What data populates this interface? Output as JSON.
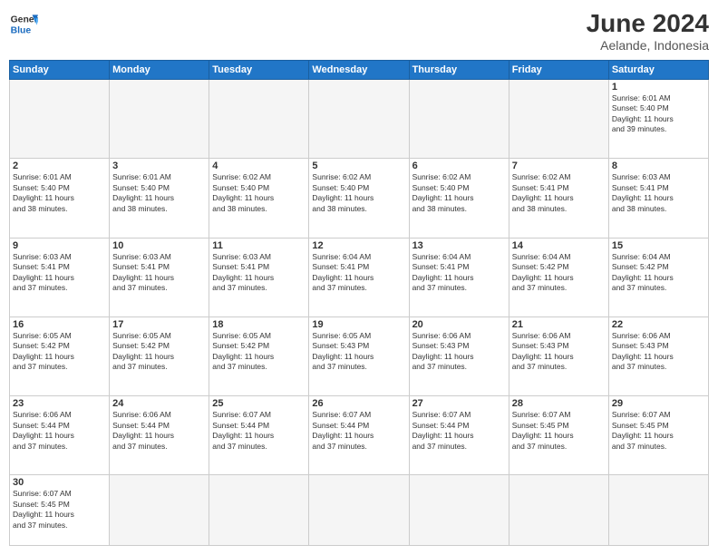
{
  "header": {
    "logo_general": "General",
    "logo_blue": "Blue",
    "month_year": "June 2024",
    "location": "Aelande, Indonesia"
  },
  "days_of_week": [
    "Sunday",
    "Monday",
    "Tuesday",
    "Wednesday",
    "Thursday",
    "Friday",
    "Saturday"
  ],
  "weeks": [
    [
      {
        "day": "",
        "info": ""
      },
      {
        "day": "",
        "info": ""
      },
      {
        "day": "",
        "info": ""
      },
      {
        "day": "",
        "info": ""
      },
      {
        "day": "",
        "info": ""
      },
      {
        "day": "",
        "info": ""
      },
      {
        "day": "1",
        "info": "Sunrise: 6:01 AM\nSunset: 5:40 PM\nDaylight: 11 hours\nand 39 minutes."
      }
    ],
    [
      {
        "day": "2",
        "info": "Sunrise: 6:01 AM\nSunset: 5:40 PM\nDaylight: 11 hours\nand 38 minutes."
      },
      {
        "day": "3",
        "info": "Sunrise: 6:01 AM\nSunset: 5:40 PM\nDaylight: 11 hours\nand 38 minutes."
      },
      {
        "day": "4",
        "info": "Sunrise: 6:02 AM\nSunset: 5:40 PM\nDaylight: 11 hours\nand 38 minutes."
      },
      {
        "day": "5",
        "info": "Sunrise: 6:02 AM\nSunset: 5:40 PM\nDaylight: 11 hours\nand 38 minutes."
      },
      {
        "day": "6",
        "info": "Sunrise: 6:02 AM\nSunset: 5:40 PM\nDaylight: 11 hours\nand 38 minutes."
      },
      {
        "day": "7",
        "info": "Sunrise: 6:02 AM\nSunset: 5:41 PM\nDaylight: 11 hours\nand 38 minutes."
      },
      {
        "day": "8",
        "info": "Sunrise: 6:03 AM\nSunset: 5:41 PM\nDaylight: 11 hours\nand 38 minutes."
      }
    ],
    [
      {
        "day": "9",
        "info": "Sunrise: 6:03 AM\nSunset: 5:41 PM\nDaylight: 11 hours\nand 37 minutes."
      },
      {
        "day": "10",
        "info": "Sunrise: 6:03 AM\nSunset: 5:41 PM\nDaylight: 11 hours\nand 37 minutes."
      },
      {
        "day": "11",
        "info": "Sunrise: 6:03 AM\nSunset: 5:41 PM\nDaylight: 11 hours\nand 37 minutes."
      },
      {
        "day": "12",
        "info": "Sunrise: 6:04 AM\nSunset: 5:41 PM\nDaylight: 11 hours\nand 37 minutes."
      },
      {
        "day": "13",
        "info": "Sunrise: 6:04 AM\nSunset: 5:41 PM\nDaylight: 11 hours\nand 37 minutes."
      },
      {
        "day": "14",
        "info": "Sunrise: 6:04 AM\nSunset: 5:42 PM\nDaylight: 11 hours\nand 37 minutes."
      },
      {
        "day": "15",
        "info": "Sunrise: 6:04 AM\nSunset: 5:42 PM\nDaylight: 11 hours\nand 37 minutes."
      }
    ],
    [
      {
        "day": "16",
        "info": "Sunrise: 6:05 AM\nSunset: 5:42 PM\nDaylight: 11 hours\nand 37 minutes."
      },
      {
        "day": "17",
        "info": "Sunrise: 6:05 AM\nSunset: 5:42 PM\nDaylight: 11 hours\nand 37 minutes."
      },
      {
        "day": "18",
        "info": "Sunrise: 6:05 AM\nSunset: 5:42 PM\nDaylight: 11 hours\nand 37 minutes."
      },
      {
        "day": "19",
        "info": "Sunrise: 6:05 AM\nSunset: 5:43 PM\nDaylight: 11 hours\nand 37 minutes."
      },
      {
        "day": "20",
        "info": "Sunrise: 6:06 AM\nSunset: 5:43 PM\nDaylight: 11 hours\nand 37 minutes."
      },
      {
        "day": "21",
        "info": "Sunrise: 6:06 AM\nSunset: 5:43 PM\nDaylight: 11 hours\nand 37 minutes."
      },
      {
        "day": "22",
        "info": "Sunrise: 6:06 AM\nSunset: 5:43 PM\nDaylight: 11 hours\nand 37 minutes."
      }
    ],
    [
      {
        "day": "23",
        "info": "Sunrise: 6:06 AM\nSunset: 5:44 PM\nDaylight: 11 hours\nand 37 minutes."
      },
      {
        "day": "24",
        "info": "Sunrise: 6:06 AM\nSunset: 5:44 PM\nDaylight: 11 hours\nand 37 minutes."
      },
      {
        "day": "25",
        "info": "Sunrise: 6:07 AM\nSunset: 5:44 PM\nDaylight: 11 hours\nand 37 minutes."
      },
      {
        "day": "26",
        "info": "Sunrise: 6:07 AM\nSunset: 5:44 PM\nDaylight: 11 hours\nand 37 minutes."
      },
      {
        "day": "27",
        "info": "Sunrise: 6:07 AM\nSunset: 5:44 PM\nDaylight: 11 hours\nand 37 minutes."
      },
      {
        "day": "28",
        "info": "Sunrise: 6:07 AM\nSunset: 5:45 PM\nDaylight: 11 hours\nand 37 minutes."
      },
      {
        "day": "29",
        "info": "Sunrise: 6:07 AM\nSunset: 5:45 PM\nDaylight: 11 hours\nand 37 minutes."
      }
    ],
    [
      {
        "day": "30",
        "info": "Sunrise: 6:07 AM\nSunset: 5:45 PM\nDaylight: 11 hours\nand 37 minutes."
      },
      {
        "day": "",
        "info": ""
      },
      {
        "day": "",
        "info": ""
      },
      {
        "day": "",
        "info": ""
      },
      {
        "day": "",
        "info": ""
      },
      {
        "day": "",
        "info": ""
      },
      {
        "day": "",
        "info": ""
      }
    ]
  ]
}
